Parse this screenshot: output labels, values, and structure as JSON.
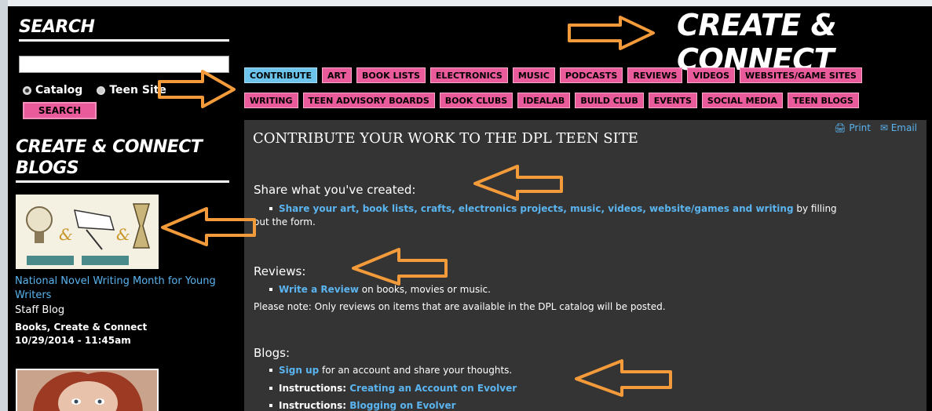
{
  "sidebar": {
    "search_title": "SEARCH",
    "radio_catalog": "Catalog",
    "radio_teen": "Teen Site",
    "search_button": "SEARCH",
    "blogs_title": "CREATE & CONNECT BLOGS",
    "blog": {
      "title": "National Novel Writing Month for Young Writers",
      "type": "Staff Blog",
      "categories": "Books, Create & Connect",
      "date": "10/29/2014 - 11:45am"
    }
  },
  "header": {
    "title": "CREATE & CONNECT"
  },
  "tabs": {
    "row1": [
      "CONTRIBUTE",
      "ART",
      "BOOK LISTS",
      "ELECTRONICS",
      "MUSIC",
      "PODCASTS",
      "REVIEWS",
      "VIDEOS",
      "WEBSITES/GAME SITES"
    ],
    "row2": [
      "WRITING",
      "TEEN ADVISORY BOARDS",
      "BOOK CLUBS",
      "IDEALAB",
      "BUILD CLUB",
      "EVENTS",
      "SOCIAL MEDIA",
      "TEEN BLOGS"
    ]
  },
  "main": {
    "title": "CONTRIBUTE YOUR WORK TO THE DPL TEEN SITE",
    "print": "Print",
    "email": "Email",
    "share_heading": "Share what you've created:",
    "share_link": "Share your art, book lists, crafts, electronics projects, music, videos, website/games and writing",
    "share_suffix": " by filling",
    "share_line2": "out the form.",
    "reviews_heading": "Reviews:",
    "review_link": "Write a Review",
    "review_suffix": " on books, movies or music.",
    "review_note": "Please note: Only reviews on items that are available in the DPL catalog will be posted.",
    "blogs_heading": "Blogs:",
    "signup_link": "Sign up",
    "signup_suffix": " for an account and share your thoughts.",
    "instructions_label": "Instructions: ",
    "instr1_link": "Creating an Account on Evolver",
    "instr2_link": "Blogging on Evolver"
  },
  "colors": {
    "tab": "#e95b9a",
    "tab_active": "#6cc3ec",
    "link": "#5ab4f0",
    "arrow": "#f39a3a",
    "panel": "#343434"
  }
}
